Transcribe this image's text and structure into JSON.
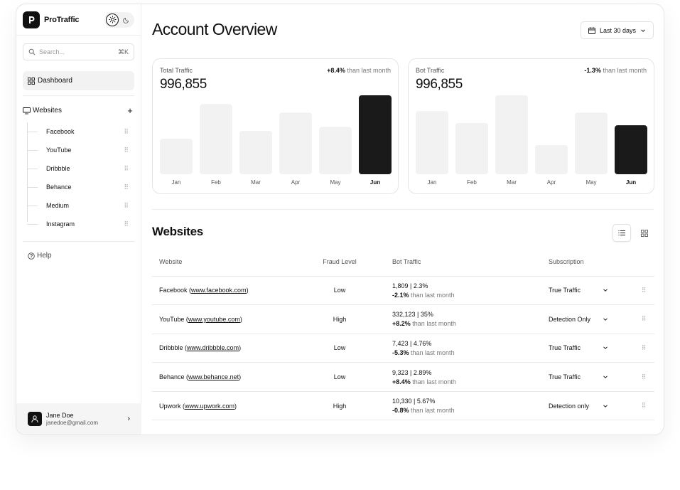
{
  "brand": {
    "name": "ProTraffic"
  },
  "search": {
    "placeholder": "Search...",
    "shortcut": "⌘K"
  },
  "sidebar": {
    "dashboard_label": "Dashboard",
    "websites_label": "Websites",
    "sites": [
      "Facebook",
      "YouTube",
      "Dribbble",
      "Behance",
      "Medium",
      "Instagram"
    ],
    "help_label": "Help"
  },
  "user": {
    "name": "Jane Doe",
    "email": "janedoe@gmail.com"
  },
  "header": {
    "title": "Account Overview",
    "date_range": "Last 30 days"
  },
  "cards": [
    {
      "label": "Total Traffic",
      "value": "996,855",
      "delta": "+8.4%",
      "delta_suffix": "than last month",
      "chart_data": {
        "type": "bar",
        "categories": [
          "Jan",
          "Feb",
          "Mar",
          "Apr",
          "May",
          "Jun"
        ],
        "values": [
          45,
          89,
          55,
          78,
          60,
          100
        ],
        "highlight": "Jun"
      }
    },
    {
      "label": "Bot Traffic",
      "value": "996,855",
      "delta": "-1.3%",
      "delta_suffix": "than last month",
      "chart_data": {
        "type": "bar",
        "categories": [
          "Jan",
          "Feb",
          "Mar",
          "Apr",
          "May",
          "Jun"
        ],
        "values": [
          80,
          65,
          100,
          37,
          78,
          62
        ],
        "highlight": "Jun"
      }
    }
  ],
  "colors": {
    "bar": "#f2f2f2",
    "bar_highlight": "#1a1a1a",
    "text": "#111111",
    "muted": "#777777"
  },
  "websites": {
    "title": "Websites",
    "columns": [
      "Website",
      "Fraud Level",
      "Bot Traffic",
      "Subscription"
    ],
    "rows": [
      {
        "name": "Facebook",
        "url": "www.facebook.com",
        "fraud": "Low",
        "bot": "1,809 | 2.3%",
        "delta": "-2.1%",
        "delta_suffix": "than last month",
        "subscription": "True Traffic"
      },
      {
        "name": "YouTube",
        "url": "www.youtube.com",
        "fraud": "High",
        "bot": "332,123 | 35%",
        "delta": "+8.2%",
        "delta_suffix": "than last month",
        "subscription": "Detection Only"
      },
      {
        "name": "Dribbble",
        "url": "www.dribbble.com",
        "fraud": "Low",
        "bot": "7,423 | 4.76%",
        "delta": "-5.3%",
        "delta_suffix": "than last month",
        "subscription": "True Traffic"
      },
      {
        "name": "Behance",
        "url": "www.behance.net",
        "fraud": "Low",
        "bot": "9,323 | 2.89%",
        "delta": "+8.4%",
        "delta_suffix": "than last month",
        "subscription": "True Traffic"
      },
      {
        "name": "Upwork",
        "url": "www.upwork.com",
        "fraud": "High",
        "bot": "10,330 | 5.67%",
        "delta": "-0.8%",
        "delta_suffix": "than last month",
        "subscription": "Detection only"
      }
    ]
  }
}
